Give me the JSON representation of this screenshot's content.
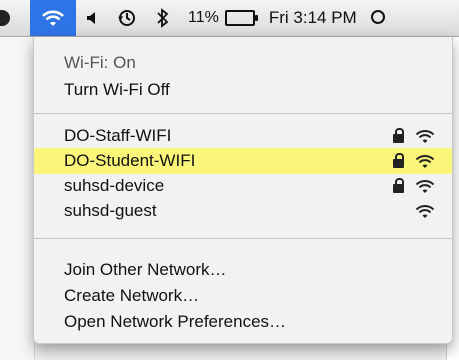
{
  "menubar": {
    "wifi_icon": "wifi-icon",
    "volume_icon": "volume-icon",
    "time_machine_icon": "time-machine-icon",
    "bluetooth_icon": "bluetooth-icon",
    "battery_percent": "11%",
    "battery_icon": "battery-icon",
    "clock": "Fri 3:14 PM",
    "spotlight_icon": "spotlight-icon"
  },
  "menu": {
    "status": "Wi-Fi: On",
    "toggle_label": "Turn Wi-Fi Off",
    "networks": [
      {
        "name": "DO-Staff-WIFI",
        "locked": true,
        "icon": "wifi-signal-icon"
      },
      {
        "name": "DO-Student-WIFI",
        "locked": true,
        "icon": "wifi-signal-icon",
        "selected": true
      },
      {
        "name": "suhsd-device",
        "locked": true,
        "icon": "wifi-signal-icon"
      },
      {
        "name": "suhsd-guest",
        "locked": false,
        "icon": "wifi-signal-icon"
      }
    ],
    "actions": [
      {
        "label": "Join Other Network…"
      },
      {
        "label": "Create Network…"
      },
      {
        "label": "Open Network Preferences…"
      }
    ]
  },
  "colors": {
    "menubar_active": "#2f74e6",
    "highlight": "#fbf57a"
  }
}
